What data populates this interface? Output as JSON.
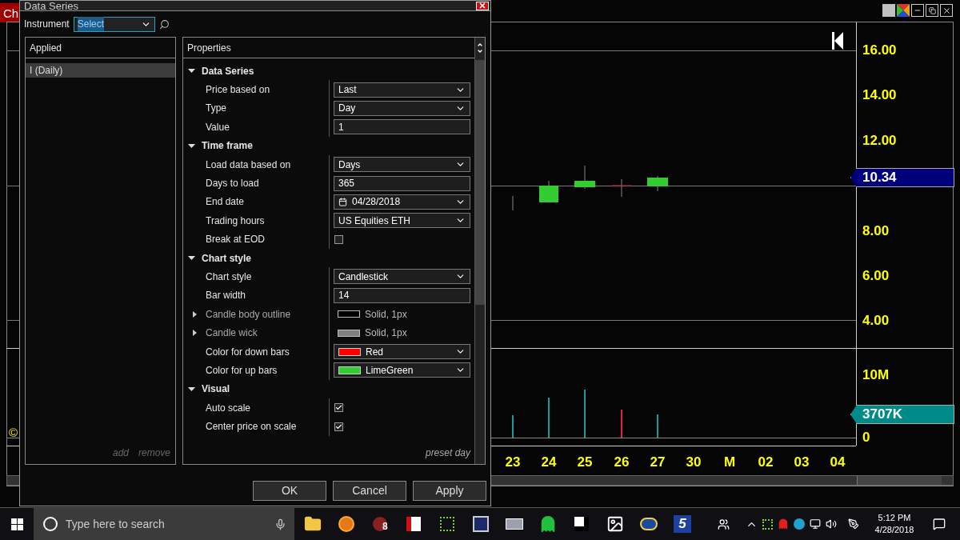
{
  "chart_window": {
    "title_tab": "Ch",
    "price_axis": [
      "16.00",
      "14.00",
      "12.00",
      "8.00",
      "6.00",
      "4.00"
    ],
    "last_price": "10.34",
    "volume_axis": [
      "10M",
      "0"
    ],
    "last_volume": "3707K",
    "date_axis": [
      "23",
      "24",
      "25",
      "26",
      "27",
      "30",
      "M",
      "02",
      "03",
      "04"
    ],
    "copyright": "©"
  },
  "dialog": {
    "title": "Data Series",
    "instrument_label": "Instrument",
    "instrument": {
      "value": "Select",
      "selected": true
    },
    "applied": {
      "header": "Applied",
      "items": [
        {
          "label": "I (Daily)",
          "selected": true
        }
      ],
      "actions": [
        "add",
        "remove"
      ]
    },
    "properties": {
      "header": "Properties",
      "footer": "preset day",
      "sections": [
        {
          "title": "Data Series",
          "expanded": true,
          "rows": [
            {
              "label": "Price based on",
              "kind": "dropdown",
              "value": "Last"
            },
            {
              "label": "Type",
              "kind": "dropdown",
              "value": "Day"
            },
            {
              "label": "Value",
              "kind": "text",
              "value": "1"
            }
          ]
        },
        {
          "title": "Time frame",
          "expanded": true,
          "rows": [
            {
              "label": "Load data based on",
              "kind": "dropdown",
              "value": "Days"
            },
            {
              "label": "Days to load",
              "kind": "text",
              "value": "365"
            },
            {
              "label": "End date",
              "kind": "date",
              "value": "04/28/2018"
            },
            {
              "label": "Trading hours",
              "kind": "dropdown",
              "value": "US Equities ETH"
            },
            {
              "label": "Break at EOD",
              "kind": "checkbox",
              "checked": false
            }
          ]
        },
        {
          "title": "Chart style",
          "expanded": true,
          "rows": [
            {
              "label": "Chart style",
              "kind": "dropdown",
              "value": "Candlestick"
            },
            {
              "label": "Bar width",
              "kind": "text",
              "value": "14"
            },
            {
              "label": "Candle body outline",
              "kind": "stroke",
              "value": "Solid, 1px",
              "color": "#000000"
            },
            {
              "label": "Candle wick",
              "kind": "stroke",
              "value": "Solid, 1px",
              "color": "#808080"
            },
            {
              "label": "Color for down bars",
              "kind": "color",
              "value": "Red",
              "color": "#ff0000"
            },
            {
              "label": "Color for up bars",
              "kind": "color",
              "value": "LimeGreen",
              "color": "#32cd32"
            }
          ]
        },
        {
          "title": "Visual",
          "expanded": true,
          "rows": [
            {
              "label": "Auto scale",
              "kind": "checkbox",
              "checked": true
            },
            {
              "label": "Center price on scale",
              "kind": "checkbox",
              "checked": true
            }
          ]
        }
      ]
    },
    "buttons": [
      "OK",
      "Cancel",
      "Apply"
    ]
  },
  "taskbar": {
    "search_placeholder": "Type here to search",
    "app_badge": "8",
    "logo_text": "5",
    "time": "5:12 PM",
    "date": "4/28/2018"
  }
}
